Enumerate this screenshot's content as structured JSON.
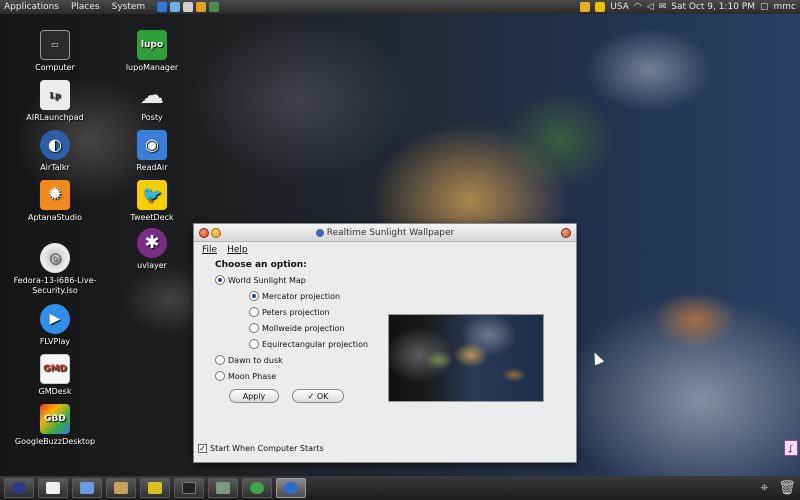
{
  "top_panel": {
    "menus": [
      "Applications",
      "Places",
      "System"
    ],
    "keyboard": "USA",
    "clock": "Sat Oct  9,  1:10 PM",
    "user": "mmc"
  },
  "desktop_icons": [
    {
      "label": "Computer",
      "glyph": "▭",
      "color": "#2a2a2a"
    },
    {
      "label": "lupoManager",
      "glyph": "lupo",
      "color": "#2e9e3a"
    },
    {
      "label": "AIRLaunchpad",
      "glyph": "Lp",
      "color": "#ececec"
    },
    {
      "label": "Posty",
      "glyph": "☁",
      "color": "#dcdcdc"
    },
    {
      "label": "AirTalkr",
      "glyph": "◐",
      "color": "#2c5fa8"
    },
    {
      "label": "ReadAir",
      "glyph": "◉",
      "color": "#3a7fd6"
    },
    {
      "label": "AptanaStudio",
      "glyph": "✹",
      "color": "#f08a1c"
    },
    {
      "label": "TweetDeck",
      "glyph": "🐦",
      "color": "#f4d000"
    },
    {
      "label": "Fedora-13-i686-Live-Security.iso",
      "glyph": "◎",
      "color": "#d8d8d8"
    },
    {
      "label": "uvlayer",
      "glyph": "✱",
      "color": "#7a2c86"
    },
    {
      "label": "FLVPlay",
      "glyph": "▶",
      "color": "#2f8ee8"
    },
    {
      "label": "GMDesk",
      "glyph": "GMD",
      "color": "#f6f6f6"
    },
    {
      "label": "GoogleBuzzDesktop",
      "glyph": "GBD",
      "color": "#e43b2c"
    }
  ],
  "window": {
    "title": "Realtime Sunlight Wallpaper",
    "menu": [
      "File",
      "Help"
    ],
    "heading": "Choose an option:",
    "options": {
      "world_map": "World Sunlight Map",
      "mercator": "Mercator projection",
      "peters": "Peters projection",
      "mollweide": "Mollweide projection",
      "equirect": "Equirectangular projection",
      "dawn": "Dawn to dusk",
      "moon": "Moon Phase"
    },
    "apply_label": "Apply",
    "ok_label": "OK",
    "startup_label": "Start When Computer Starts",
    "startup_checked": true
  },
  "colors": {
    "accent": "#1d4d9e",
    "panel": "#2a2a2a"
  }
}
